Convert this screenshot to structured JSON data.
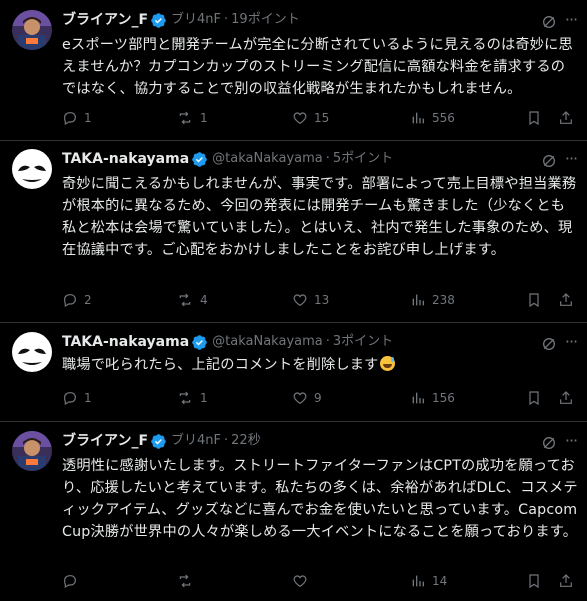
{
  "posts": [
    {
      "name": "ブライアン_F",
      "handle": "",
      "meta": "ブリ4nF",
      "time": "19ポイント",
      "text": "eスポーツ部門と開発チームが完全に分断されているように見えるのは奇妙に思えませんか？カプコンカップのストリーミング配信に高額な料金を請求するのではなく、協力することで別の収益化戦略が生まれたかもしれません。",
      "replies": "1",
      "reposts": "1",
      "likes": "15",
      "views": "556",
      "avatar": "gamer-avatar"
    },
    {
      "name": "TAKA-nakayama",
      "handle": "@takaNakayama",
      "meta": "",
      "time": "5ポイント",
      "text": "奇妙に聞こえるかもしれませんが、事実です。部署によって売上目標や担当業務が根本的に異なるため、今回の発表には開発チームも驚きました（少なくとも私と松本は会場で驚いていました）。とはいえ、社内で発生した事象のため、現在協議中です。ご心配をおかけしましたことをお詫び申し上げます。",
      "replies": "2",
      "reposts": "4",
      "likes": "13",
      "views": "238",
      "avatar": "mask-avatar"
    },
    {
      "name": "TAKA-nakayama",
      "handle": "@takaNakayama",
      "meta": "",
      "time": "3ポイント",
      "text": "職場で叱られたら、上記のコメントを削除します",
      "replies": "1",
      "reposts": "1",
      "likes": "9",
      "views": "156",
      "avatar": "mask-avatar"
    },
    {
      "name": "ブライアン_F",
      "handle": "",
      "meta": "ブリ4nF",
      "time": "22秒",
      "text": "透明性に感謝いたします。ストリートファイターファンはCPTの成功を願っており、応援したいと考えています。私たちの多くは、余裕があればDLC、コスメティックアイテム、グッズなどに喜んでお金を使いたいと思っています。Capcom Cup決勝が世界中の人々が楽しめる一大イベントになることを願っております。",
      "replies": "",
      "reposts": "",
      "likes": "",
      "views": "14",
      "avatar": "gamer-avatar"
    }
  ],
  "icons": {
    "verified": "verified-badge-icon",
    "grok": "grok-icon",
    "more": "more-icon",
    "reply": "reply-icon",
    "repost": "repost-icon",
    "like": "like-icon",
    "views": "views-icon",
    "bookmark": "bookmark-icon",
    "share": "share-icon",
    "emoji": "sweat-smile-emoji"
  },
  "colors": {
    "background": "#000000",
    "text": "#e7e9ea",
    "muted": "#71767b",
    "divider": "#2f3336",
    "verified": "#1d9bf0"
  }
}
